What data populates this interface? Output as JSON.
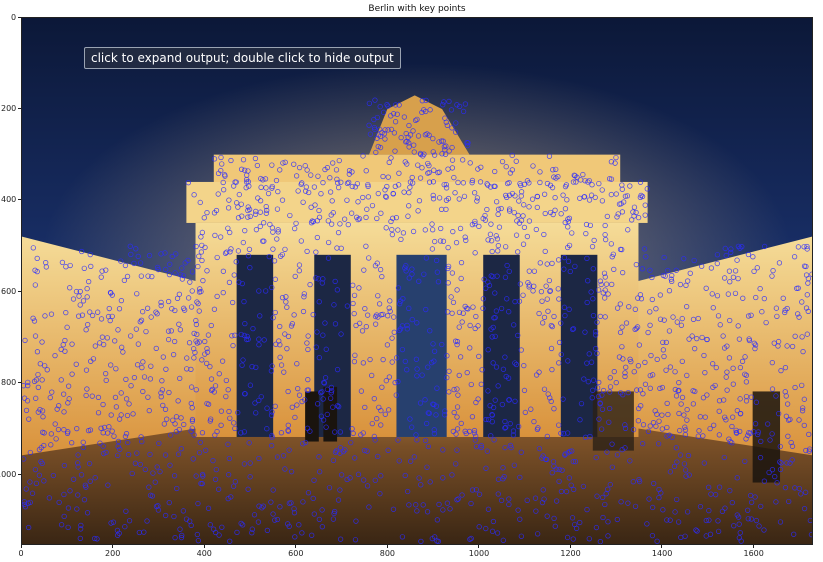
{
  "figure": {
    "title": "Berlin with key points"
  },
  "output_tooltip": {
    "text": "click to expand output; double click to hide output"
  },
  "image_plot": {
    "description_free": true,
    "x_axis": {
      "min": 0,
      "max": 1730,
      "ticks": [
        0,
        200,
        400,
        600,
        800,
        1000,
        1200,
        1400,
        1600
      ]
    },
    "y_axis": {
      "min": 0,
      "max": 1155,
      "inverted": true,
      "ticks": [
        0,
        200,
        400,
        600,
        800,
        1000
      ]
    },
    "keypoint_color": "#2a2aff"
  },
  "colors": {
    "sky_top": "#0c1838",
    "sky_mid": "#1b3370",
    "stone_light": "#f3d48a",
    "stone_warm": "#e0a24a",
    "ground": "#5a3d22"
  }
}
